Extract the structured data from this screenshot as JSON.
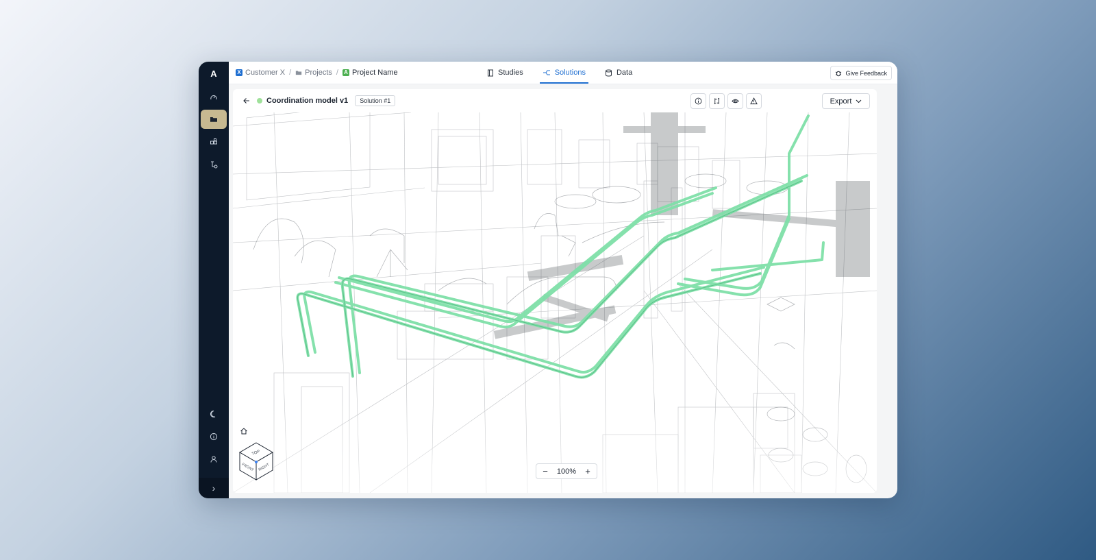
{
  "rail": {
    "logo": "A",
    "items": [
      {
        "name": "gauge-icon"
      },
      {
        "name": "folder-icon",
        "active": true
      },
      {
        "name": "blocks-icon"
      },
      {
        "name": "route-settings-icon"
      }
    ],
    "bottom": [
      {
        "name": "moon-icon"
      },
      {
        "name": "info-icon"
      },
      {
        "name": "user-icon"
      }
    ],
    "expand": "›"
  },
  "breadcrumb": {
    "customer": {
      "badge": "X",
      "label": "Customer X",
      "color": "#1f6fd1"
    },
    "sep": "/",
    "projects": {
      "label": "Projects"
    },
    "project": {
      "badge": "A",
      "label": "Project Name",
      "color": "#4caf50"
    }
  },
  "tabs": [
    {
      "label": "Studies",
      "icon": "document-icon",
      "active": false
    },
    {
      "label": "Solutions",
      "icon": "branch-icon",
      "active": true
    },
    {
      "label": "Data",
      "icon": "database-icon",
      "active": false
    }
  ],
  "feedback": {
    "label": "Give Feedback",
    "icon": "bug-icon"
  },
  "model": {
    "name": "Coordination model v1",
    "status_color": "#9fe19a",
    "badge": "Solution #1"
  },
  "toolbar": {
    "icons": [
      "info-icon",
      "compare-icon",
      "eye-icon",
      "warning-icon"
    ],
    "export_label": "Export"
  },
  "viewcube": {
    "top": "TOP",
    "front": "FRONT",
    "right": "RIGHT"
  },
  "zoom": {
    "minus": "−",
    "value": "100%",
    "plus": "+"
  },
  "colors": {
    "pipe": "#7fe0a8",
    "accent": "#1f6fd1",
    "rail": "#0d1a2b",
    "rail_active": "#c7b991"
  }
}
